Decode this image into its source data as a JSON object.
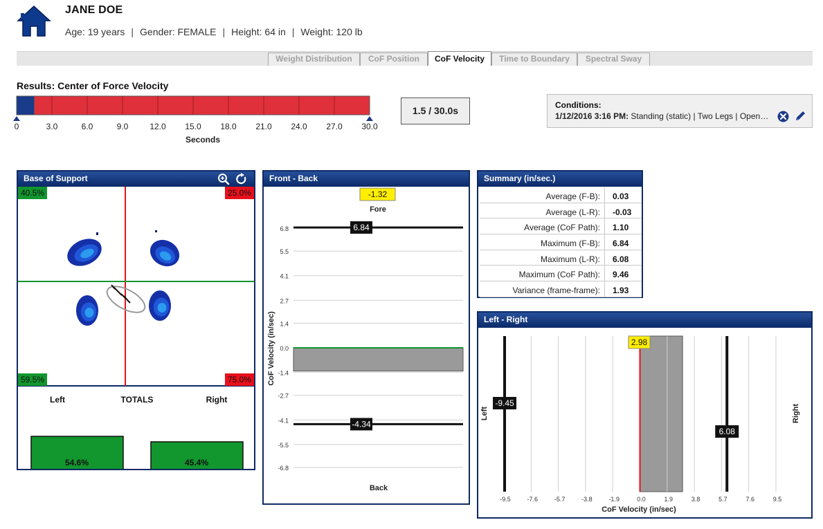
{
  "header": {
    "name": "JANE DOE",
    "age": "Age: 19 years",
    "gender": "Gender: FEMALE",
    "height": "Height: 64 in",
    "weight": "Weight: 120 lb",
    "separator": "|"
  },
  "tabs": [
    {
      "label": "Weight Distribution",
      "active": false
    },
    {
      "label": "CoF Position",
      "active": false
    },
    {
      "label": "CoF Velocity",
      "active": true
    },
    {
      "label": "Time to Boundary",
      "active": false
    },
    {
      "label": "Spectral Sway",
      "active": false
    }
  ],
  "timeline": {
    "title": "Results: Center of Force Velocity",
    "ticks": [
      "0",
      "3.0",
      "6.0",
      "9.0",
      "12.0",
      "15.0",
      "18.0",
      "21.0",
      "24.0",
      "27.0",
      "30.0"
    ],
    "axis_label": "Seconds",
    "current_time": 1.5,
    "total_time": 30.0,
    "time_display": "1.5 / 30.0s",
    "colors": {
      "played": "#1a3a8a",
      "remaining": "#e0303c"
    }
  },
  "conditions": {
    "title": "Conditions:",
    "date": "1/12/2016 3:16 PM:",
    "description": "Standing (static) | Two Legs | Open…",
    "clear_icon": "clear-circle-icon",
    "edit_icon": "pencil-icon"
  },
  "base_of_support": {
    "title": "Base of Support",
    "zoom_icon": "zoom-in-icon",
    "reset_icon": "rotate-icon",
    "quadrants": {
      "top_left": "40.5%",
      "top_right": "25.0%",
      "bottom_left": "59.5%",
      "bottom_right": "75.0%"
    },
    "totals": {
      "left_label": "Left",
      "center_label": "TOTALS",
      "right_label": "Right",
      "left_value": "54.6%",
      "right_value": "45.4%"
    },
    "colors": {
      "green": "#12962e",
      "red": "#e8101c",
      "blue": "#1c3aa8"
    }
  },
  "front_back": {
    "title": "Front - Back",
    "top_badge": "-1.32",
    "top_label": "Fore",
    "bottom_label": "Back",
    "y_axis_label": "CoF Velocity (in/sec)",
    "y_ticks": [
      "6.8",
      "5.5",
      "4.1",
      "2.7",
      "1.4",
      "0.0",
      "-1.4",
      "-2.7",
      "-4.1",
      "-5.5",
      "-6.8"
    ],
    "max_value": 6.84,
    "min_value": -4.34,
    "max_label": "6.84",
    "min_label": "-4.34",
    "current_value": -1.32
  },
  "summary": {
    "title": "Summary (in/sec.)",
    "rows": [
      {
        "label": "Average (F-B):",
        "value": "0.03"
      },
      {
        "label": "Average (L-R):",
        "value": "-0.03"
      },
      {
        "label": "Average (CoF Path):",
        "value": "1.10"
      },
      {
        "label": "Maximum (F-B):",
        "value": "6.84"
      },
      {
        "label": "Maximum (L-R):",
        "value": "6.08"
      },
      {
        "label": "Maximum (CoF Path):",
        "value": "9.46"
      },
      {
        "label": "Variance (frame-frame):",
        "value": "1.93"
      }
    ]
  },
  "left_right": {
    "title": "Left - Right",
    "left_label": "Left",
    "right_label": "Right",
    "x_axis_label": "CoF Velocity (in/sec)",
    "x_ticks": [
      "-9.5",
      "-7.6",
      "-5.7",
      "-3.8",
      "-1.9",
      "0.0",
      "1.9",
      "3.8",
      "5.7",
      "7.6",
      "9.5"
    ],
    "min_value": -9.45,
    "max_value": 6.08,
    "min_label": "-9.45",
    "max_label": "6.08",
    "current_value": 2.98,
    "current_label": "2.98"
  }
}
